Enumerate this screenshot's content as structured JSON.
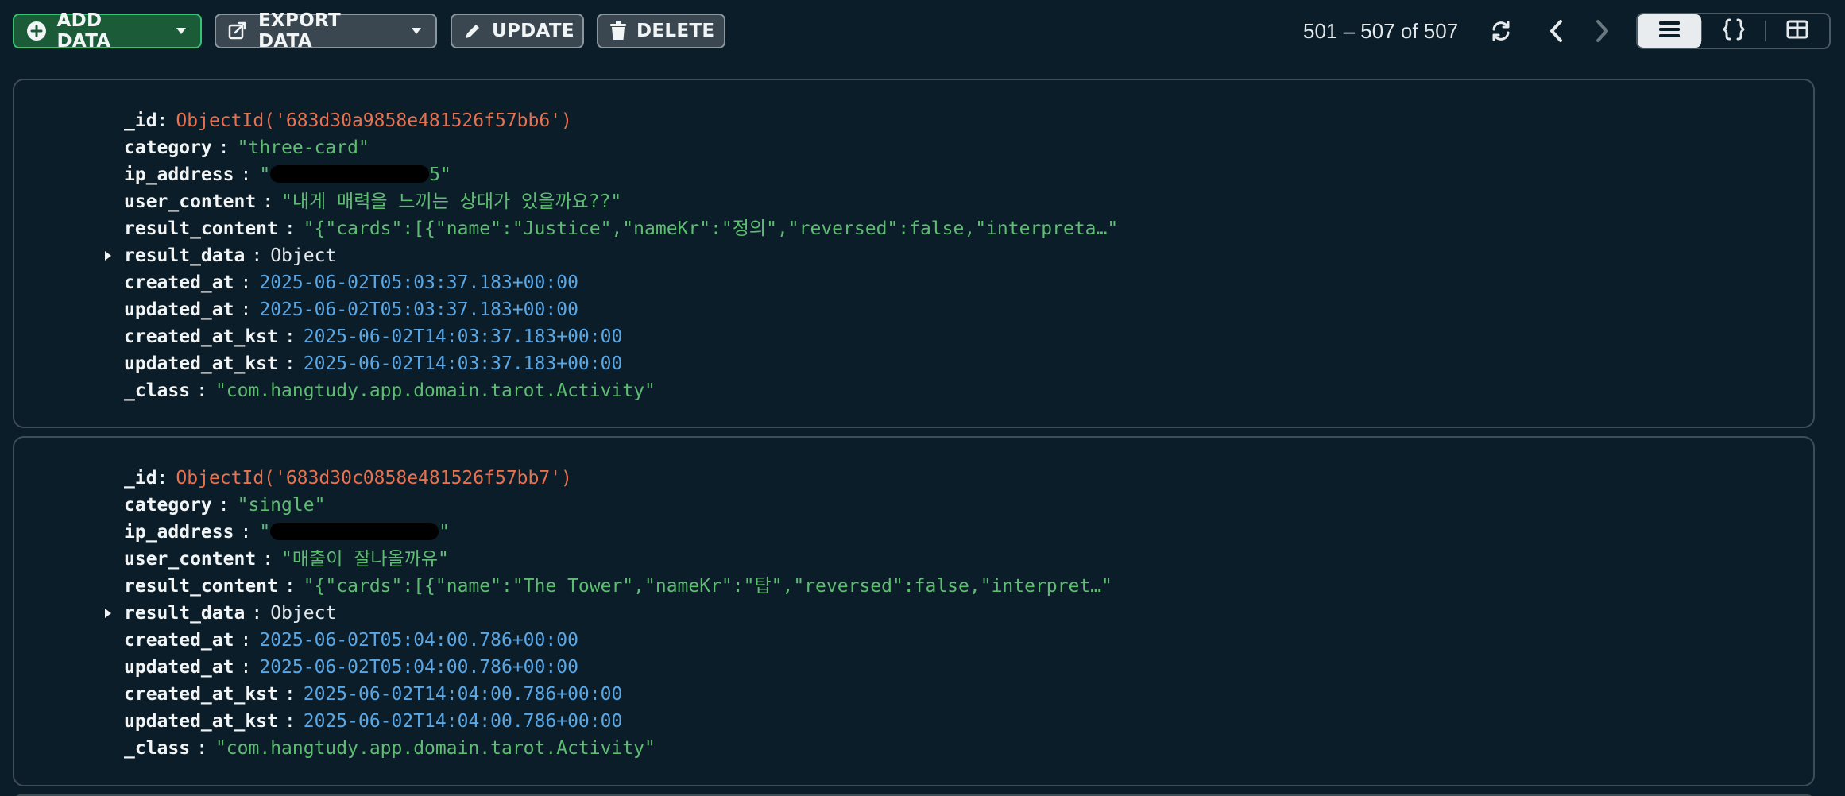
{
  "toolbar": {
    "add_data_label": "ADD DATA",
    "export_data_label": "EXPORT DATA",
    "update_label": "UPDATE",
    "delete_label": "DELETE",
    "pagination_text": "501 – 507 of 507",
    "icons": {
      "add": "plus-circle-icon",
      "export": "export-icon",
      "update": "pencil-icon",
      "delete": "trash-icon",
      "refresh": "refresh-icon",
      "prev": "chevron-left-icon",
      "next": "chevron-right-icon",
      "list_view": "list-view-icon",
      "json_view": "json-view-icon",
      "table_view": "table-view-icon"
    }
  },
  "colors": {
    "background": "#0b1d28",
    "objectid": "#e8714f",
    "string": "#5ebd72",
    "date": "#5aa7e6",
    "add_button_bg": "#1b5b37",
    "add_button_border": "#35c271"
  },
  "documents": [
    {
      "id_key": "_id",
      "id_value": "ObjectId('683d30a9858e481526f57bb6')",
      "category_key": "category",
      "category_value": "\"three-card\"",
      "ip_key": "ip_address",
      "ip_prefix": "\"",
      "ip_suffix": "5\"",
      "user_content_key": "user_content",
      "user_content_value": "\"내게 매력을 느끼는 상대가 있을까요??\"",
      "result_content_key": "result_content",
      "result_content_value": "\"{\"cards\":[{\"name\":\"Justice\",\"nameKr\":\"정의\",\"reversed\":false,\"interpreta…\"",
      "result_data_key": "result_data",
      "result_data_value": "Object",
      "created_at_key": "created_at",
      "created_at_value": "2025-06-02T05:03:37.183+00:00",
      "updated_at_key": "updated_at",
      "updated_at_value": "2025-06-02T05:03:37.183+00:00",
      "created_at_kst_key": "created_at_kst",
      "created_at_kst_value": "2025-06-02T14:03:37.183+00:00",
      "updated_at_kst_key": "updated_at_kst",
      "updated_at_kst_value": "2025-06-02T14:03:37.183+00:00",
      "class_key": "_class",
      "class_value": "\"com.hangtudy.app.domain.tarot.Activity\""
    },
    {
      "id_key": "_id",
      "id_value": "ObjectId('683d30c0858e481526f57bb7')",
      "category_key": "category",
      "category_value": "\"single\"",
      "ip_key": "ip_address",
      "ip_prefix": "\"",
      "ip_suffix": "\"",
      "user_content_key": "user_content",
      "user_content_value": "\"매출이 잘나올까유\"",
      "result_content_key": "result_content",
      "result_content_value": "\"{\"cards\":[{\"name\":\"The Tower\",\"nameKr\":\"탑\",\"reversed\":false,\"interpret…\"",
      "result_data_key": "result_data",
      "result_data_value": "Object",
      "created_at_key": "created_at",
      "created_at_value": "2025-06-02T05:04:00.786+00:00",
      "updated_at_key": "updated_at",
      "updated_at_value": "2025-06-02T05:04:00.786+00:00",
      "created_at_kst_key": "created_at_kst",
      "created_at_kst_value": "2025-06-02T14:04:00.786+00:00",
      "updated_at_kst_key": "updated_at_kst",
      "updated_at_kst_value": "2025-06-02T14:04:00.786+00:00",
      "class_key": "_class",
      "class_value": "\"com.hangtudy.app.domain.tarot.Activity\""
    }
  ]
}
